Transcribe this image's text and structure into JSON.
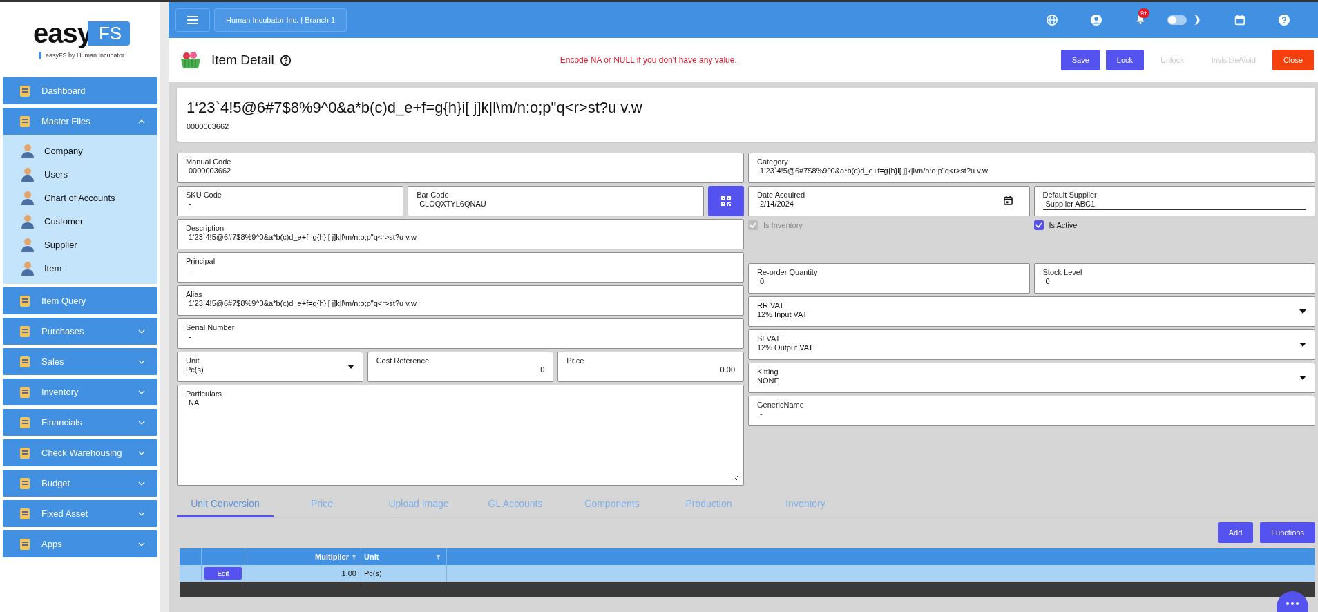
{
  "sidebar": {
    "logo": {
      "word": "easy",
      "badge": "FS",
      "tagline": "easyFS by Human Incubator"
    },
    "items": [
      {
        "label": "Dashboard",
        "kind": "link"
      },
      {
        "label": "Master Files",
        "kind": "group",
        "expanded": true,
        "children": [
          {
            "label": "Company"
          },
          {
            "label": "Users"
          },
          {
            "label": "Chart of Accounts"
          },
          {
            "label": "Customer"
          },
          {
            "label": "Supplier"
          },
          {
            "label": "Item"
          }
        ]
      },
      {
        "label": "Item Query",
        "kind": "link"
      },
      {
        "label": "Purchases",
        "kind": "group",
        "expanded": false
      },
      {
        "label": "Sales",
        "kind": "group",
        "expanded": false
      },
      {
        "label": "Inventory",
        "kind": "group",
        "expanded": false
      },
      {
        "label": "Financials",
        "kind": "group",
        "expanded": false
      },
      {
        "label": "Check Warehousing",
        "kind": "group",
        "expanded": false
      },
      {
        "label": "Budget",
        "kind": "group",
        "expanded": false
      },
      {
        "label": "Fixed Asset",
        "kind": "group",
        "expanded": false
      },
      {
        "label": "Apps",
        "kind": "group",
        "expanded": false
      }
    ]
  },
  "topbar": {
    "company": "Human Incubator Inc. | Branch 1",
    "notifications": "9+",
    "theme_toggle": {
      "on": false
    }
  },
  "header": {
    "title": "Item Detail",
    "notice": "Encode NA or NULL if you don't have any value.",
    "buttons": [
      {
        "label": "Save",
        "kind": "primary",
        "disabled": false
      },
      {
        "label": "Lock",
        "kind": "primary",
        "disabled": false
      },
      {
        "label": "Unlock",
        "kind": "primary",
        "disabled": true
      },
      {
        "label": "Invisible/Void",
        "kind": "primary",
        "disabled": true
      },
      {
        "label": "Close",
        "kind": "danger",
        "disabled": false
      }
    ]
  },
  "item": {
    "name": "1‘23`4!5@6#7$8%9^0&a*b(c)d_e+f=g{h}i[ j]k|l\\m/n:o;p\"q<r>st?u v.w",
    "code": "0000003662"
  },
  "form": {
    "left": [
      [
        {
          "label": "Manual Code",
          "value": "0000003662",
          "kind": "text"
        }
      ],
      [
        {
          "label": "SKU Code",
          "value": "-",
          "kind": "text"
        },
        {
          "label": "Bar Code",
          "value": "CLOQXTYL6QNAU",
          "kind": "barcode"
        }
      ],
      [
        {
          "label": "Description",
          "value": "1‘23`4!5@6#7$8%9^0&a*b(c)d_e+f=g{h}i[ j]k|l\\m/n:o;p\"q<r>st?u v.w",
          "kind": "text"
        }
      ],
      [
        {
          "label": "Principal",
          "value": "-",
          "kind": "text"
        }
      ],
      [
        {
          "label": "Alias",
          "value": "1‘23`4!5@6#7$8%9^0&a*b(c)d_e+f=g{h}i[ j]k|l\\m/n:o;p\"q<r>st?u v.w",
          "kind": "text"
        }
      ],
      [
        {
          "label": "Serial Number",
          "value": "-",
          "kind": "text"
        }
      ],
      [
        {
          "label": "Unit",
          "value": "Pc(s)",
          "kind": "select"
        },
        {
          "label": "Cost Reference",
          "value": "0",
          "kind": "number"
        },
        {
          "label": "Price",
          "value": "0.00",
          "kind": "number"
        }
      ],
      [
        {
          "label": "Particulars",
          "value": "NA",
          "kind": "textarea"
        }
      ]
    ],
    "right": [
      [
        {
          "label": "Category",
          "value": "1‘23`4!5@6#7$8%9^0&a*b(c)d_e+f=g{h}i[ j]k|l\\m/n:o;p\"q<r>st?u v.w",
          "kind": "text"
        }
      ],
      [
        {
          "label": "Date Acquired",
          "value": "2/14/2024",
          "kind": "date"
        },
        {
          "label": "Default Supplier",
          "value": "Supplier ABC1",
          "kind": "underlined"
        }
      ],
      [
        {
          "label": "Is Inventory",
          "kind": "checkbox",
          "checked": true,
          "disabled": true
        },
        {
          "label": "Is Active",
          "kind": "checkbox",
          "checked": true,
          "disabled": false
        }
      ],
      [
        {
          "label": "Re-order Quantity",
          "value": "0",
          "kind": "text"
        },
        {
          "label": "Stock Level",
          "value": "0",
          "kind": "text"
        }
      ],
      [
        {
          "label": "RR VAT",
          "value": "12% Input VAT",
          "kind": "select"
        }
      ],
      [
        {
          "label": "SI VAT",
          "value": "12% Output VAT",
          "kind": "select"
        }
      ],
      [
        {
          "label": "Kitting",
          "value": "NONE",
          "kind": "select"
        }
      ],
      [
        {
          "label": "GenericName",
          "value": "-",
          "kind": "text"
        }
      ]
    ]
  },
  "tabs": [
    {
      "label": "Unit Conversion",
      "selected": true
    },
    {
      "label": "Price",
      "selected": false
    },
    {
      "label": "Upload Image",
      "selected": false
    },
    {
      "label": "GL Accounts",
      "selected": false
    },
    {
      "label": "Components",
      "selected": false
    },
    {
      "label": "Production",
      "selected": false
    },
    {
      "label": "Inventory",
      "selected": false
    }
  ],
  "actions": [
    "Add",
    "Functions"
  ],
  "table": {
    "columns": [
      {
        "label": "Multiplier",
        "kind": "number"
      },
      {
        "label": "Unit",
        "kind": "text"
      }
    ],
    "rows": [
      {
        "action": "Edit",
        "cells": [
          "1.00",
          "Pc(s)"
        ]
      }
    ]
  }
}
